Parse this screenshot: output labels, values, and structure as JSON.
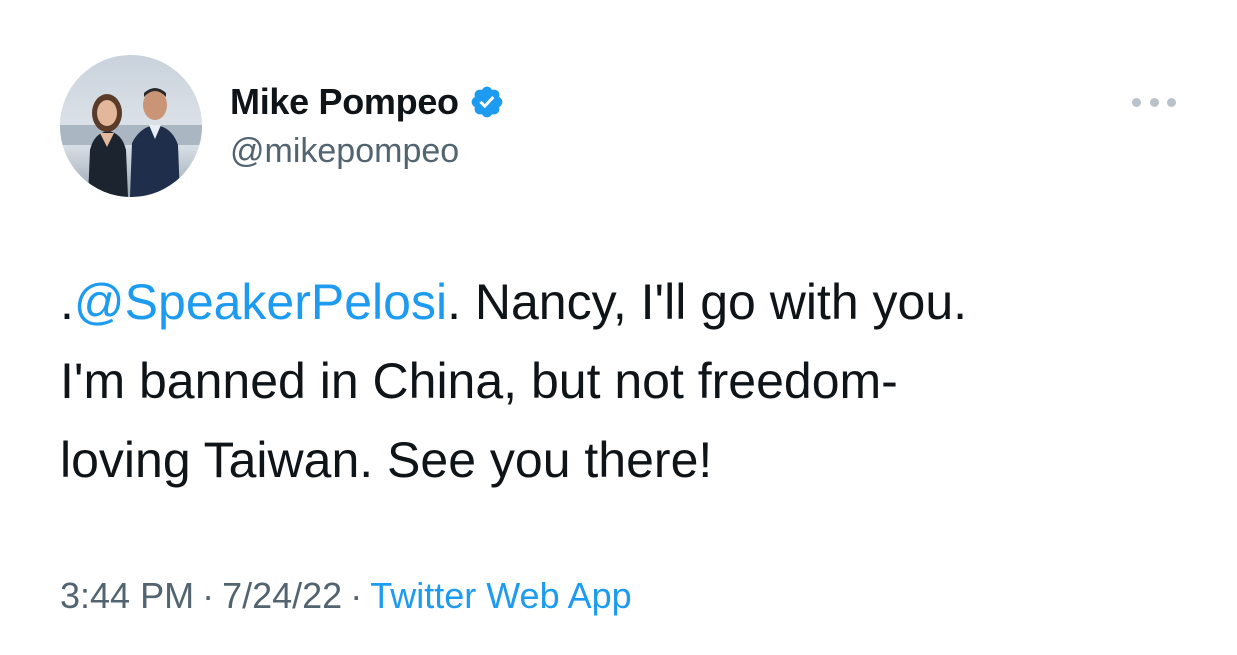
{
  "author": {
    "display_name": "Mike Pompeo",
    "handle": "@mikepompeo",
    "verified": true,
    "avatar_icon": "profile-photo"
  },
  "tweet": {
    "mention_prefix": ".",
    "mention": "@SpeakerPelosi",
    "line1_rest": ". Nancy, I'll go with you.",
    "line2": "I'm banned in China, but not freedom-",
    "line3": "loving Taiwan.  See you there!"
  },
  "meta": {
    "time": "3:44 PM",
    "separator": "·",
    "date": "7/24/22",
    "source": "Twitter Web App"
  },
  "icons": {
    "verified_badge": "verified-badge-icon",
    "more": "more-options-icon"
  },
  "colors": {
    "link": "#1d9bf0",
    "secondary_text": "#536471",
    "primary_text": "#0f1419"
  }
}
